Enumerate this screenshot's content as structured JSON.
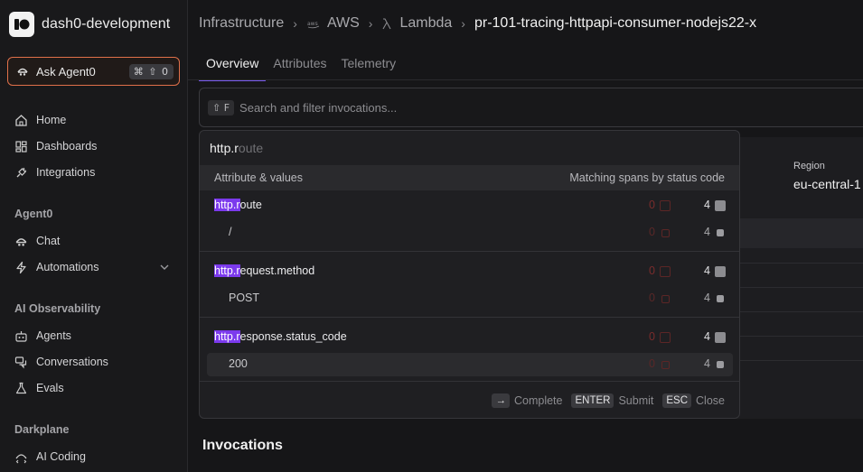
{
  "org": {
    "name": "dash0-development"
  },
  "ask": {
    "label": "Ask Agent0",
    "shortcut": "⌘ ⇧ 0"
  },
  "nav": {
    "home": "Home",
    "dashboards": "Dashboards",
    "integrations": "Integrations"
  },
  "sections": {
    "agent0": {
      "title": "Agent0",
      "chat": "Chat",
      "automations": "Automations"
    },
    "ai": {
      "title": "AI Observability",
      "agents": "Agents",
      "conversations": "Conversations",
      "evals": "Evals"
    },
    "darkplane": {
      "title": "Darkplane",
      "ai_coding": "AI Coding"
    }
  },
  "breadcrumb": {
    "infrastructure": "Infrastructure",
    "aws": "AWS",
    "lambda": "Lambda",
    "function": "pr-101-tracing-httpapi-consumer-nodejs22-x"
  },
  "tabs": [
    "Overview",
    "Attributes",
    "Telemetry"
  ],
  "search": {
    "shortcut": "⇧ F",
    "placeholder": "Search and filter invocations..."
  },
  "background": {
    "region_label": "Region",
    "region_value": "eu-central-1",
    "section_title": "Invocations"
  },
  "popup": {
    "query_typed": "http.r",
    "query_ghost": "oute",
    "col_left": "Attribute & values",
    "col_right": "Matching spans by status code",
    "groups": [
      {
        "match": "http.r",
        "rest": "oute",
        "value": "/",
        "error_count": "0",
        "ok_count": "4",
        "value_error_count": "0",
        "value_ok_count": "4"
      },
      {
        "match": "http.r",
        "rest": "equest.method",
        "value": "POST",
        "error_count": "0",
        "ok_count": "4",
        "value_error_count": "0",
        "value_ok_count": "4"
      },
      {
        "match": "http.r",
        "rest": "esponse.status_code",
        "value": "200",
        "error_count": "0",
        "ok_count": "4",
        "value_error_count": "0",
        "value_ok_count": "4"
      }
    ],
    "footer": {
      "complete_key": "→",
      "complete_label": "Complete",
      "submit_key": "ENTER",
      "submit_label": "Submit",
      "close_key": "ESC",
      "close_label": "Close"
    }
  },
  "colors": {
    "accent": "#7a5cf0",
    "highlight": "#7c3aed",
    "ask_border": "#e0704a"
  }
}
